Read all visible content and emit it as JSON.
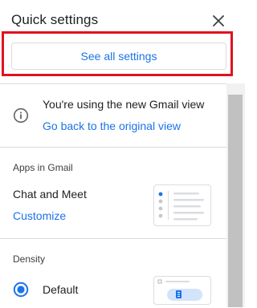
{
  "header": {
    "title": "Quick settings",
    "close_icon": "close-icon"
  },
  "see_all": {
    "label": "See all settings"
  },
  "gmail_view": {
    "icon": "info-icon",
    "message": "You're using the new Gmail view",
    "link": "Go back to the original view"
  },
  "apps": {
    "heading": "Apps in Gmail",
    "chat_label": "Chat and Meet",
    "customize_link": "Customize"
  },
  "density": {
    "heading": "Density",
    "options": [
      {
        "label": "Default",
        "selected": true
      }
    ]
  },
  "colors": {
    "accent": "#1a73e8",
    "highlight": "#e0121e",
    "border": "#dadce0"
  }
}
